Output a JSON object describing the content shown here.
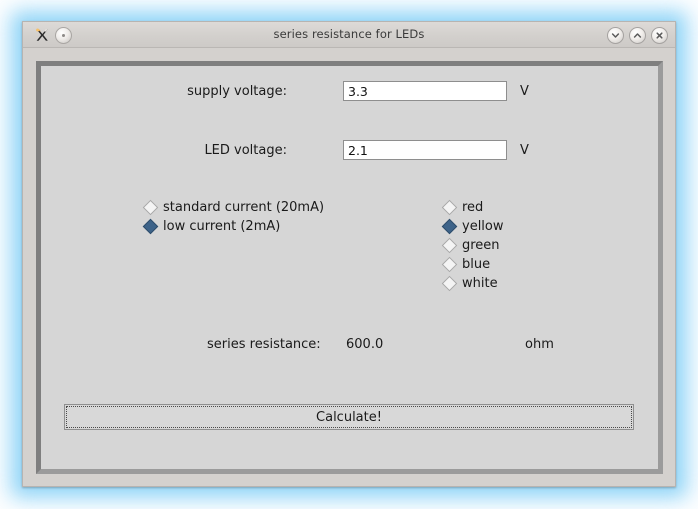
{
  "window": {
    "title": "series resistance for LEDs",
    "app_icon": "x11-app-icon",
    "menu_button_icon": "window-menu-icon",
    "controls": [
      {
        "name": "minimize",
        "icon": "chevron-down-icon"
      },
      {
        "name": "maximize",
        "icon": "chevron-up-icon"
      },
      {
        "name": "close",
        "icon": "close-x-icon"
      }
    ]
  },
  "form": {
    "supply_voltage": {
      "label": "supply voltage:",
      "value": "3.3",
      "placeholder": "",
      "unit": "V"
    },
    "led_voltage": {
      "label": "LED voltage:",
      "value": "2.1",
      "placeholder": "",
      "unit": "V"
    }
  },
  "current_options": {
    "selected": "low current (2mA)",
    "items": [
      {
        "label": "standard current (20mA)",
        "selected": false
      },
      {
        "label": "low current (2mA)",
        "selected": true
      }
    ]
  },
  "color_options": {
    "selected": "yellow",
    "items": [
      {
        "label": "red",
        "selected": false
      },
      {
        "label": "yellow",
        "selected": true
      },
      {
        "label": "green",
        "selected": false
      },
      {
        "label": "blue",
        "selected": false
      },
      {
        "label": "white",
        "selected": false
      }
    ]
  },
  "result": {
    "label": "series resistance:",
    "value": "600.0",
    "unit": "ohm"
  },
  "actions": {
    "calculate_label": "Calculate!"
  },
  "colors": {
    "window_chrome": "#d4d1ce",
    "content_background": "#d6d6d6",
    "sunken_border_dark": "#7f7f7f",
    "sunken_border_light": "#9b9b9b",
    "radio_selected": "#3d6389",
    "focus_glow": "#8fd4f7",
    "text": "#1a1a1a"
  }
}
